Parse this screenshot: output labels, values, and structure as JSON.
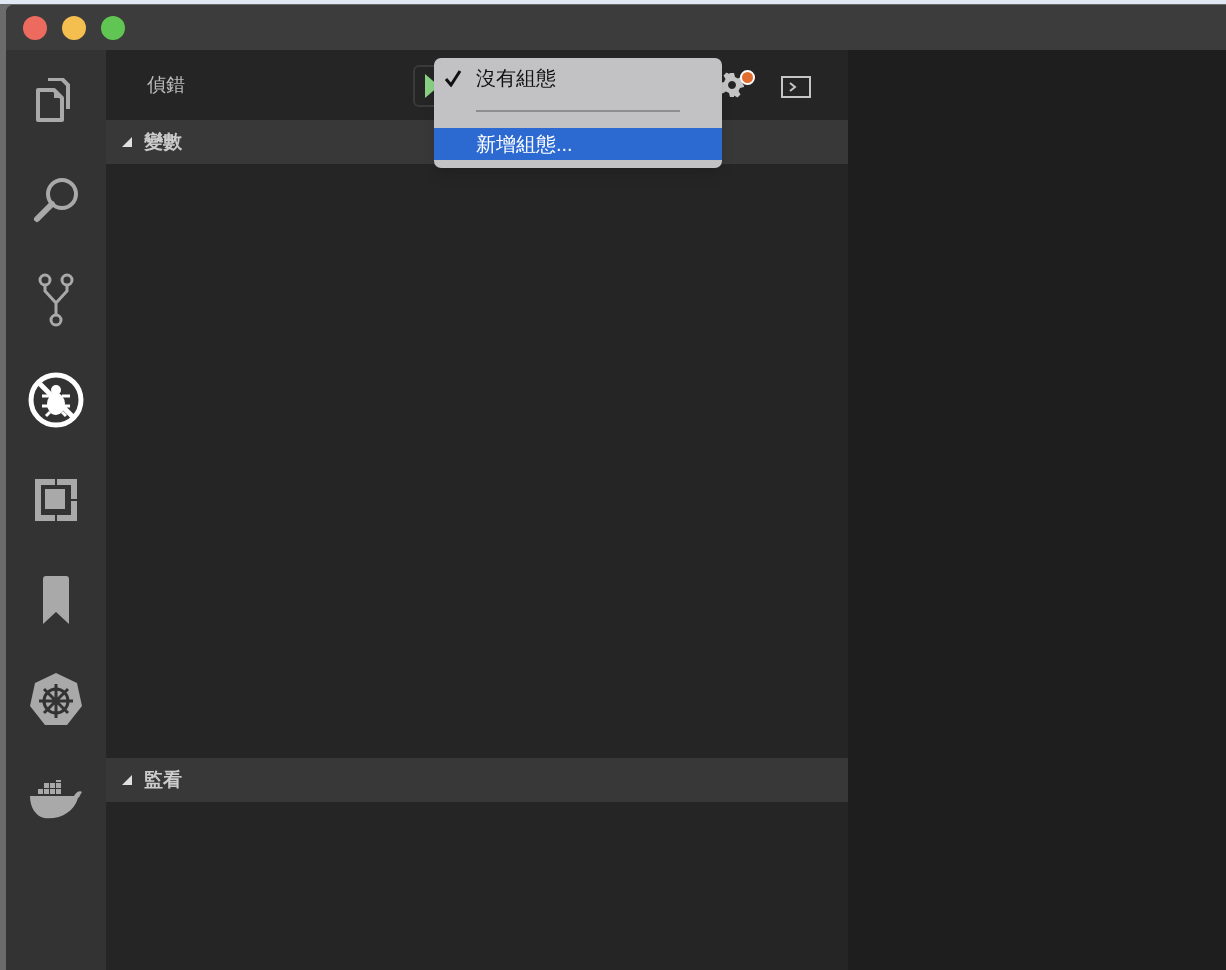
{
  "activity_bar": {
    "items": [
      {
        "selected": false
      },
      {
        "selected": false
      },
      {
        "selected": false
      },
      {
        "selected": true
      },
      {
        "selected": false
      },
      {
        "selected": false
      },
      {
        "selected": false
      },
      {
        "selected": false
      }
    ]
  },
  "sidebar": {
    "title": "偵錯",
    "sections": [
      {
        "title": "變數",
        "expanded": true
      },
      {
        "title": "監看",
        "expanded": true
      }
    ]
  },
  "config_menu": {
    "items": [
      {
        "kind": "item",
        "label": "沒有組態",
        "checked": true,
        "selected": false
      },
      {
        "kind": "separator"
      },
      {
        "kind": "item",
        "label": "新增組態...",
        "checked": false,
        "selected": true
      }
    ]
  }
}
